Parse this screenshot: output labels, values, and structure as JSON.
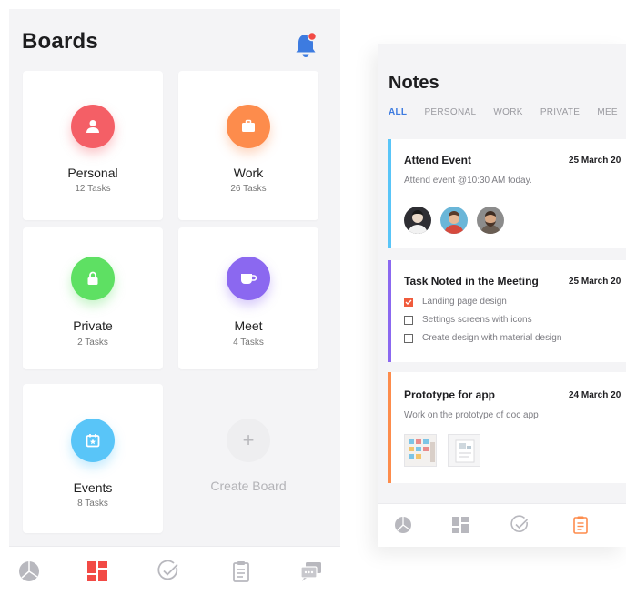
{
  "left": {
    "title": "Boards",
    "boards": [
      {
        "name": "Personal",
        "tasks": "12 Tasks",
        "color": "#f45f66",
        "icon": "person-icon"
      },
      {
        "name": "Work",
        "tasks": "26 Tasks",
        "color": "#fd8c4c",
        "icon": "briefcase-icon"
      },
      {
        "name": "Private",
        "tasks": "2 Tasks",
        "color": "#5ee063",
        "icon": "lock-icon"
      },
      {
        "name": "Meet",
        "tasks": "4 Tasks",
        "color": "#8b68f0",
        "icon": "coffee-cup-icon"
      },
      {
        "name": "Events",
        "tasks": "8 Tasks",
        "color": "#59c5f8",
        "icon": "calendar-icon"
      }
    ],
    "create_board": {
      "plus": "+",
      "label": "Create Board"
    }
  },
  "right": {
    "title": "Notes",
    "tabs": [
      "ALL",
      "PERSONAL",
      "WORK",
      "PRIVATE",
      "MEE"
    ],
    "notes": [
      {
        "title": "Attend Event",
        "date": "25 March 20",
        "text": "Attend event @10:30 AM today.",
        "accent": "#59c5f8"
      },
      {
        "title": "Task Noted in the Meeting",
        "date": "25 March 20",
        "accent": "#8b68f0",
        "checklist": [
          {
            "text": "Landing page design",
            "checked": true
          },
          {
            "text": "Settings screens with icons",
            "checked": false
          },
          {
            "text": "Create design with material design",
            "checked": false
          }
        ]
      },
      {
        "title": "Prototype for app",
        "date": "24 March 20",
        "text": "Work on the prototype of doc app",
        "accent": "#fd8c4c"
      }
    ]
  },
  "colors": {
    "active_nav_left": "#f24a45",
    "active_nav_right": "#fd8c4c",
    "active_tab": "#3d7be0",
    "bell": "#3d7be0",
    "bell_dot": "#f24a45"
  }
}
